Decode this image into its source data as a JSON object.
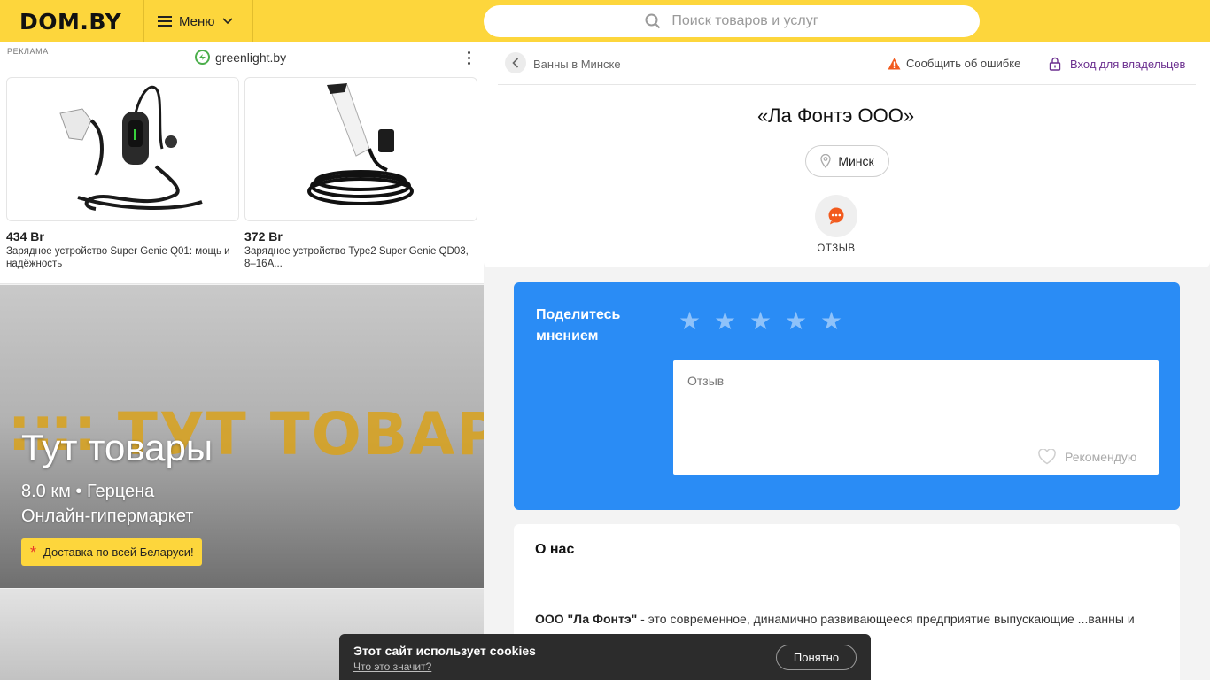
{
  "header": {
    "logo": "DOM.BY",
    "menu_label": "Меню",
    "search_placeholder": "Поиск товаров и услуг",
    "bg_color": "#fdd63c"
  },
  "ad": {
    "label": "РЕКЛАМА",
    "brand": "greenlight.by",
    "products": [
      {
        "price": "434 Br",
        "title": "Зарядное устройство Super Genie Q01: мощь и надёжность"
      },
      {
        "price": "372 Br",
        "title": "Зарядное устройство Type2 Super Genie QD03, 8–16A..."
      }
    ]
  },
  "promo": {
    "brand_text": "∷∷ ТУТ ТОВАРЫ",
    "title": "Тут товары",
    "distance": "8.0 км • Герцена",
    "subtitle": "Онлайн-гипермаркет",
    "badge": "Доставка по всей Беларуси!"
  },
  "company": {
    "breadcrumb": "Ванны в Минске",
    "report_label": "Сообщить об ошибке",
    "owners_label": "Вход для владельцев",
    "name": "«Ла Фонтэ ООО»",
    "city": "Минск",
    "review_action": "ОТЗЫВ"
  },
  "share": {
    "title": "Поделитесь мнением",
    "rating": 0,
    "max_rating": 5,
    "review_placeholder": "Отзыв",
    "recommend_label": "Рекомендую",
    "accent_color": "#2a8cf5"
  },
  "about": {
    "heading": "О нас",
    "text_bold": "ООО \"Ла Фонтэ\"",
    "text": " - это современное, динамично развивающееся предприятие выпускающие ...ванны и поддоны из экологически чистых"
  },
  "cookie": {
    "title": "Этот сайт использует cookies",
    "link": "Что это значит?",
    "button": "Понятно"
  }
}
